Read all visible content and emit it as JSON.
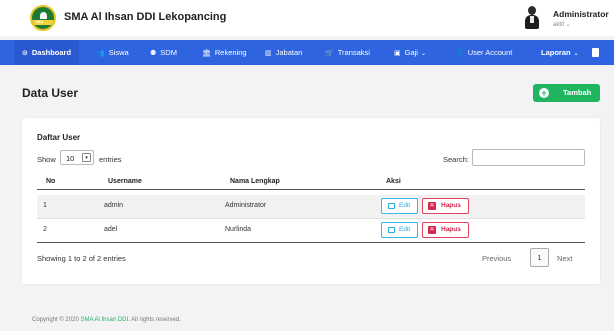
{
  "header": {
    "app_title": "SMA Al Ihsan DDI Lekopancing",
    "logo_text": "DDI",
    "user_name": "Administrator",
    "user_status": "aktif ⌄"
  },
  "nav": {
    "items": [
      {
        "label": "Dashboard",
        "icon": "dashboard-icon"
      },
      {
        "label": "Siswa",
        "icon": "users-icon"
      },
      {
        "label": "SDM",
        "icon": "people-icon"
      },
      {
        "label": "Rekening",
        "icon": "bank-icon"
      },
      {
        "label": "Jabatan",
        "icon": "chart-icon"
      },
      {
        "label": "Transaksi",
        "icon": "cart-icon"
      },
      {
        "label": "Gaji",
        "icon": "money-icon"
      },
      {
        "label": "User Account",
        "icon": "user-icon"
      }
    ],
    "laporan": "Laporan",
    "accent": "#2f64e0"
  },
  "page": {
    "title": "Data User",
    "add_button": "Tambah"
  },
  "table_card": {
    "title": "Daftar User",
    "show_label": "Show",
    "entries_value": "10",
    "entries_label": "entries",
    "search_label": "Search:",
    "columns": [
      "No",
      "Username",
      "Nama Lengkap",
      "Aksi"
    ],
    "rows": [
      {
        "no": "1",
        "username": "admin",
        "nama": "Administrator",
        "edit": "Edit",
        "hapus": "Hapus"
      },
      {
        "no": "2",
        "username": "adel",
        "nama": "Nurlinda",
        "edit": "Edit",
        "hapus": "Hapus"
      }
    ],
    "info": "Showing 1 to 2 of 2 entries",
    "prev": "Previous",
    "page": "1",
    "next": "Next"
  },
  "footer": {
    "prefix": "Copyright © 2020",
    "brand": "SMA Al Ihsan DDI.",
    "suffix": "All rights reserved."
  }
}
